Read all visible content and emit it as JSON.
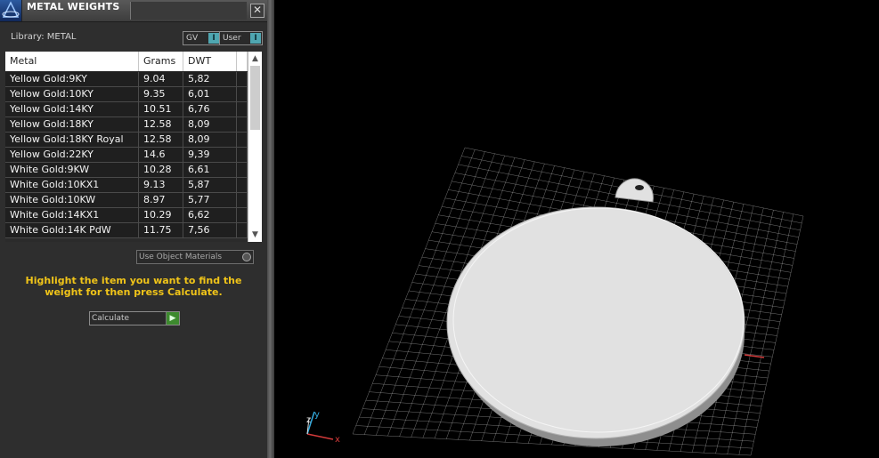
{
  "panel": {
    "title": "METAL WEIGHTS",
    "close_glyph": "✕",
    "library_label": "Library: METAL",
    "toggles": [
      {
        "label": "GV",
        "state": "I"
      },
      {
        "label": "User",
        "state": "I"
      }
    ]
  },
  "table": {
    "columns": [
      "Metal",
      "Grams",
      "DWT"
    ],
    "rows": [
      {
        "metal": "Yellow Gold:9KY",
        "grams": "9.04",
        "dwt": "5,82"
      },
      {
        "metal": "Yellow Gold:10KY",
        "grams": "9.35",
        "dwt": "6,01"
      },
      {
        "metal": "Yellow Gold:14KY",
        "grams": "10.51",
        "dwt": "6,76"
      },
      {
        "metal": "Yellow Gold:18KY",
        "grams": "12.58",
        "dwt": "8,09"
      },
      {
        "metal": "Yellow Gold:18KY Royal",
        "grams": "12.58",
        "dwt": "8,09"
      },
      {
        "metal": "Yellow Gold:22KY",
        "grams": "14.6",
        "dwt": "9,39"
      },
      {
        "metal": "White Gold:9KW",
        "grams": "10.28",
        "dwt": "6,61"
      },
      {
        "metal": "White Gold:10KX1",
        "grams": "9.13",
        "dwt": "5,87"
      },
      {
        "metal": "White Gold:10KW",
        "grams": "8.97",
        "dwt": "5,77"
      },
      {
        "metal": "White Gold:14KX1",
        "grams": "10.29",
        "dwt": "6,62"
      },
      {
        "metal": "White Gold:14K PdW",
        "grams": "11.75",
        "dwt": "7,56"
      }
    ],
    "scroll_up": "▲",
    "scroll_down": "▼"
  },
  "use_object_materials": "Use Object Materials",
  "instruction": "Highlight the item you want to find the weight for then press Calculate.",
  "calculate_button": "Calculate",
  "calculate_go": "▶",
  "viewport": {
    "axis_labels": {
      "x": "x",
      "y": "y",
      "z": "z"
    },
    "colors": {
      "background": "#000000",
      "grid": "#d0d0d0",
      "model": "#dcdcdc",
      "x_axis": "#d23a3a",
      "y_axis": "#33aadd",
      "z_axis": "#dddddd"
    }
  }
}
